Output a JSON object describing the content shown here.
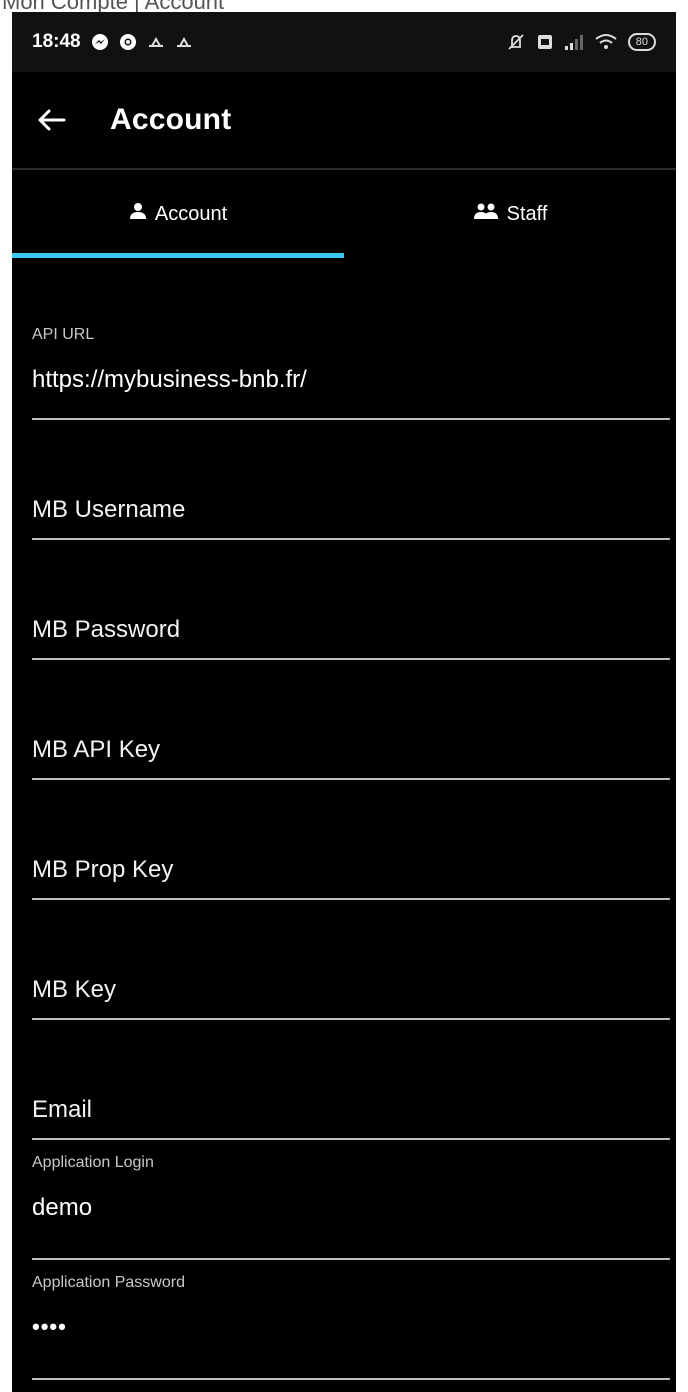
{
  "page_caption": "Mon Compte | Account",
  "status_bar": {
    "time": "18:48",
    "battery": "80"
  },
  "appbar": {
    "title": "Account"
  },
  "tabs": [
    {
      "label": "Account",
      "icon": "person-icon",
      "active": true
    },
    {
      "label": "Staff",
      "icon": "people-icon",
      "active": false
    }
  ],
  "accent_color": "#3cc8f0",
  "form": {
    "api_url": {
      "label": "API URL",
      "value": "https://mybusiness-bnb.fr/"
    },
    "mb_username": {
      "placeholder": "MB Username"
    },
    "mb_password": {
      "placeholder": "MB Password"
    },
    "mb_api_key": {
      "placeholder": "MB API Key"
    },
    "mb_prop_key": {
      "placeholder": "MB Prop Key"
    },
    "mb_key": {
      "placeholder": "MB Key"
    },
    "email": {
      "placeholder": "Email"
    },
    "application_login": {
      "label": "Application Login",
      "value": "demo"
    },
    "application_password": {
      "label": "Application Password",
      "value": "••••"
    }
  }
}
